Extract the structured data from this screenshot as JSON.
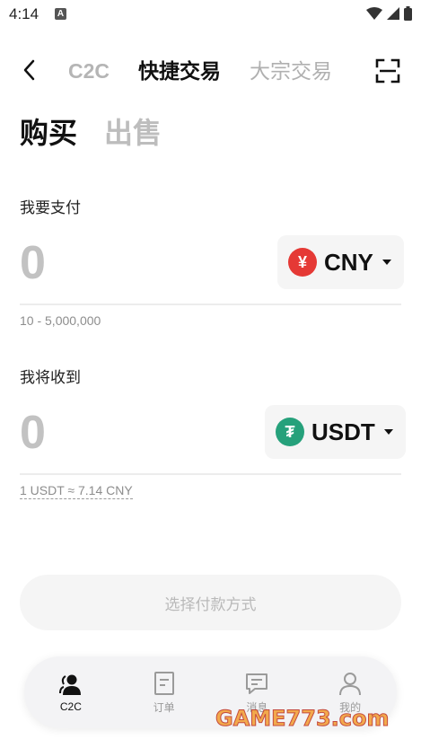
{
  "status_bar": {
    "time": "4:14",
    "notification_badge": "A",
    "icons": [
      "wifi-icon",
      "signal-icon",
      "battery-icon"
    ]
  },
  "header": {
    "tabs": [
      {
        "label": "C2C",
        "active": false
      },
      {
        "label": "快捷交易",
        "active": true
      },
      {
        "label": "大宗交易",
        "active": false
      }
    ],
    "icons": [
      "back-icon",
      "scan-icon"
    ]
  },
  "trade_side": {
    "buy_label": "购买",
    "sell_label": "出售",
    "active": "buy"
  },
  "pay": {
    "label": "我要支付",
    "value": "0",
    "currency_code": "CNY",
    "currency_symbol": "¥",
    "currency_color": "#e53935",
    "limit_hint": "10 - 5,000,000"
  },
  "receive": {
    "label": "我将收到",
    "value": "0",
    "currency_code": "USDT",
    "currency_symbol": "₮",
    "currency_color": "#26a17b",
    "rate_hint": "1 USDT ≈ 7.14 CNY"
  },
  "cta": {
    "label": "选择付款方式",
    "enabled": false
  },
  "bottom_nav": {
    "items": [
      {
        "label": "C2C",
        "icon": "people-icon",
        "active": true
      },
      {
        "label": "订单",
        "icon": "order-icon",
        "active": false
      },
      {
        "label": "消息",
        "icon": "message-icon",
        "active": false
      },
      {
        "label": "我的",
        "icon": "profile-icon",
        "active": false
      }
    ]
  },
  "watermark": {
    "text": "GAME773.com"
  }
}
